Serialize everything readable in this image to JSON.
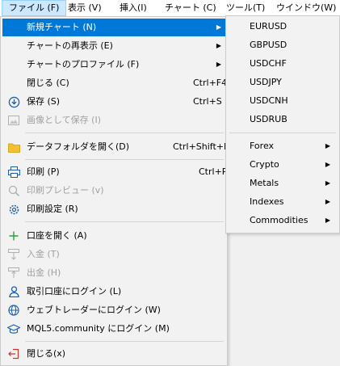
{
  "menubar": {
    "items": [
      "ファイル (F)",
      "表示 (V)",
      "挿入(I)",
      "チャート (C)",
      "ツール(T)",
      "ウインドウ(W)"
    ]
  },
  "file_menu": {
    "items": [
      {
        "label": "新規チャート (N)",
        "shortcut": "",
        "icon": "",
        "state": "selected",
        "submenu": true
      },
      {
        "label": "チャートの再表示 (E)",
        "shortcut": "",
        "icon": "",
        "state": "enabled",
        "submenu": true
      },
      {
        "label": "チャートのプロファイル (F)",
        "shortcut": "",
        "icon": "",
        "state": "enabled",
        "submenu": true
      },
      {
        "label": "閉じる (C)",
        "shortcut": "Ctrl+F4",
        "icon": "",
        "state": "enabled",
        "submenu": false
      },
      {
        "label": "保存 (S)",
        "shortcut": "Ctrl+S",
        "icon": "save-icon",
        "state": "enabled",
        "submenu": false
      },
      {
        "label": "画像として保存 (I)",
        "shortcut": "",
        "icon": "image-icon",
        "state": "disabled",
        "submenu": false
      },
      {
        "label": "データフォルダを開く(D)",
        "shortcut": "Ctrl+Shift+D",
        "icon": "folder-icon",
        "state": "enabled",
        "submenu": false
      },
      {
        "label": "印刷 (P)",
        "shortcut": "Ctrl+P",
        "icon": "printer-icon",
        "state": "enabled",
        "submenu": false
      },
      {
        "label": "印刷プレビュー (v)",
        "shortcut": "",
        "icon": "print-preview-icon",
        "state": "disabled",
        "submenu": false
      },
      {
        "label": "印刷設定 (R)",
        "shortcut": "",
        "icon": "print-settings-icon",
        "state": "enabled",
        "submenu": false
      },
      {
        "label": "口座を開く (A)",
        "shortcut": "",
        "icon": "plus-icon",
        "state": "enabled",
        "submenu": false
      },
      {
        "label": "入金 (T)",
        "shortcut": "",
        "icon": "deposit-icon",
        "state": "disabled",
        "submenu": false
      },
      {
        "label": "出金 (H)",
        "shortcut": "",
        "icon": "withdraw-icon",
        "state": "disabled",
        "submenu": false
      },
      {
        "label": "取引口座にログイン (L)",
        "shortcut": "",
        "icon": "user-icon",
        "state": "enabled",
        "submenu": false
      },
      {
        "label": "ウェブトレーダーにログイン (W)",
        "shortcut": "",
        "icon": "globe-icon",
        "state": "enabled",
        "submenu": false
      },
      {
        "label": "MQL5.community にログイン (M)",
        "shortcut": "",
        "icon": "graduation-cap-icon",
        "state": "enabled",
        "submenu": false
      },
      {
        "label": "閉じる(x)",
        "shortcut": "",
        "icon": "exit-icon",
        "state": "enabled",
        "submenu": false
      }
    ]
  },
  "new_chart_submenu": {
    "symbols": [
      "EURUSD",
      "GBPUSD",
      "USDCHF",
      "USDJPY",
      "USDCNH",
      "USDRUB"
    ],
    "categories": [
      "Forex",
      "Crypto",
      "Metals",
      "Indexes",
      "Commodities"
    ]
  },
  "colors": {
    "selection": "#0078d7",
    "menubar_active": "#cce8ff",
    "disabled_text": "#a0a0a0",
    "icon_blue": "#1e5fa8",
    "folder_yellow": "#f2c12e",
    "exit_red": "#c0392b",
    "plus_green": "#2e9e3e"
  }
}
